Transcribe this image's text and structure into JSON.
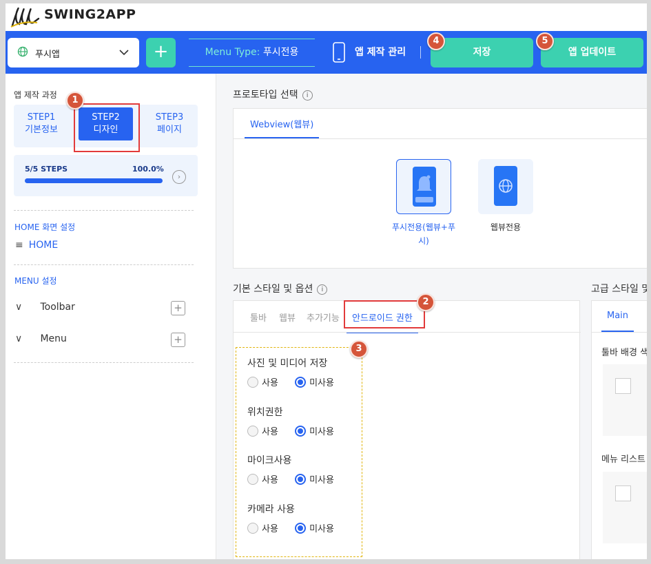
{
  "logo": {
    "text": "SWING2APP"
  },
  "toolbar": {
    "app_name": "푸시앱",
    "add_label": "+",
    "menu_type_key": "Menu Type:",
    "menu_type_value": "푸시전용",
    "app_mgmt": "앱 제작 관리",
    "save": "저장",
    "update": "앱 업데이트"
  },
  "badges": [
    "1",
    "2",
    "3",
    "4",
    "5"
  ],
  "sidebar": {
    "title": "앱 제작 과정",
    "steps": [
      {
        "line1": "STEP1",
        "line2": "기본정보"
      },
      {
        "line1": "STEP2",
        "line2": "디자인"
      },
      {
        "line1": "STEP3",
        "line2": "페이지"
      }
    ],
    "progress": {
      "label": "5/5 STEPS",
      "percent_text": "100.0%",
      "value": 1.0,
      "arrow": "›"
    },
    "home_section": "HOME 화면 설정",
    "home_item": "HOME",
    "home_icon": "≡",
    "menu_section": "MENU 설정",
    "menu_items": [
      {
        "label": "Toolbar"
      },
      {
        "label": "Menu"
      }
    ],
    "menu_chevron": "∨",
    "menu_plus": "+"
  },
  "prototype": {
    "title": "프로토타입 선택",
    "info": "i",
    "tab": "Webview(웹뷰)",
    "options": [
      {
        "label": "푸시전용(웹뷰+푸\n시)",
        "selected": true
      },
      {
        "label": "웹뷰전용",
        "selected": false
      }
    ]
  },
  "basic_style": {
    "title": "기본 스타일 및 옵션",
    "info": "i",
    "tabs": [
      "툴바",
      "웹뷰",
      "추가기능",
      "안드로이드 권한"
    ],
    "permissions": [
      {
        "label": "사진 및 미디어 저장",
        "use": "사용",
        "unused": "미사용",
        "selected": "미사용"
      },
      {
        "label": "위치권한",
        "use": "사용",
        "unused": "미사용",
        "selected": "미사용"
      },
      {
        "label": "마이크사용",
        "use": "사용",
        "unused": "미사용",
        "selected": "미사용"
      },
      {
        "label": "카메라 사용",
        "use": "사용",
        "unused": "미사용",
        "selected": "미사용"
      }
    ]
  },
  "advanced_style": {
    "title": "고급 스타일 및",
    "tab": "Main",
    "toolbar_bg": "툴바 배경 색",
    "menu_list": "메뉴 리스트"
  },
  "colors": {
    "brand_blue": "#2763f0",
    "teal": "#3cd1b0",
    "badge_red": "#d5553a",
    "highlight_red": "#e23a3a"
  }
}
